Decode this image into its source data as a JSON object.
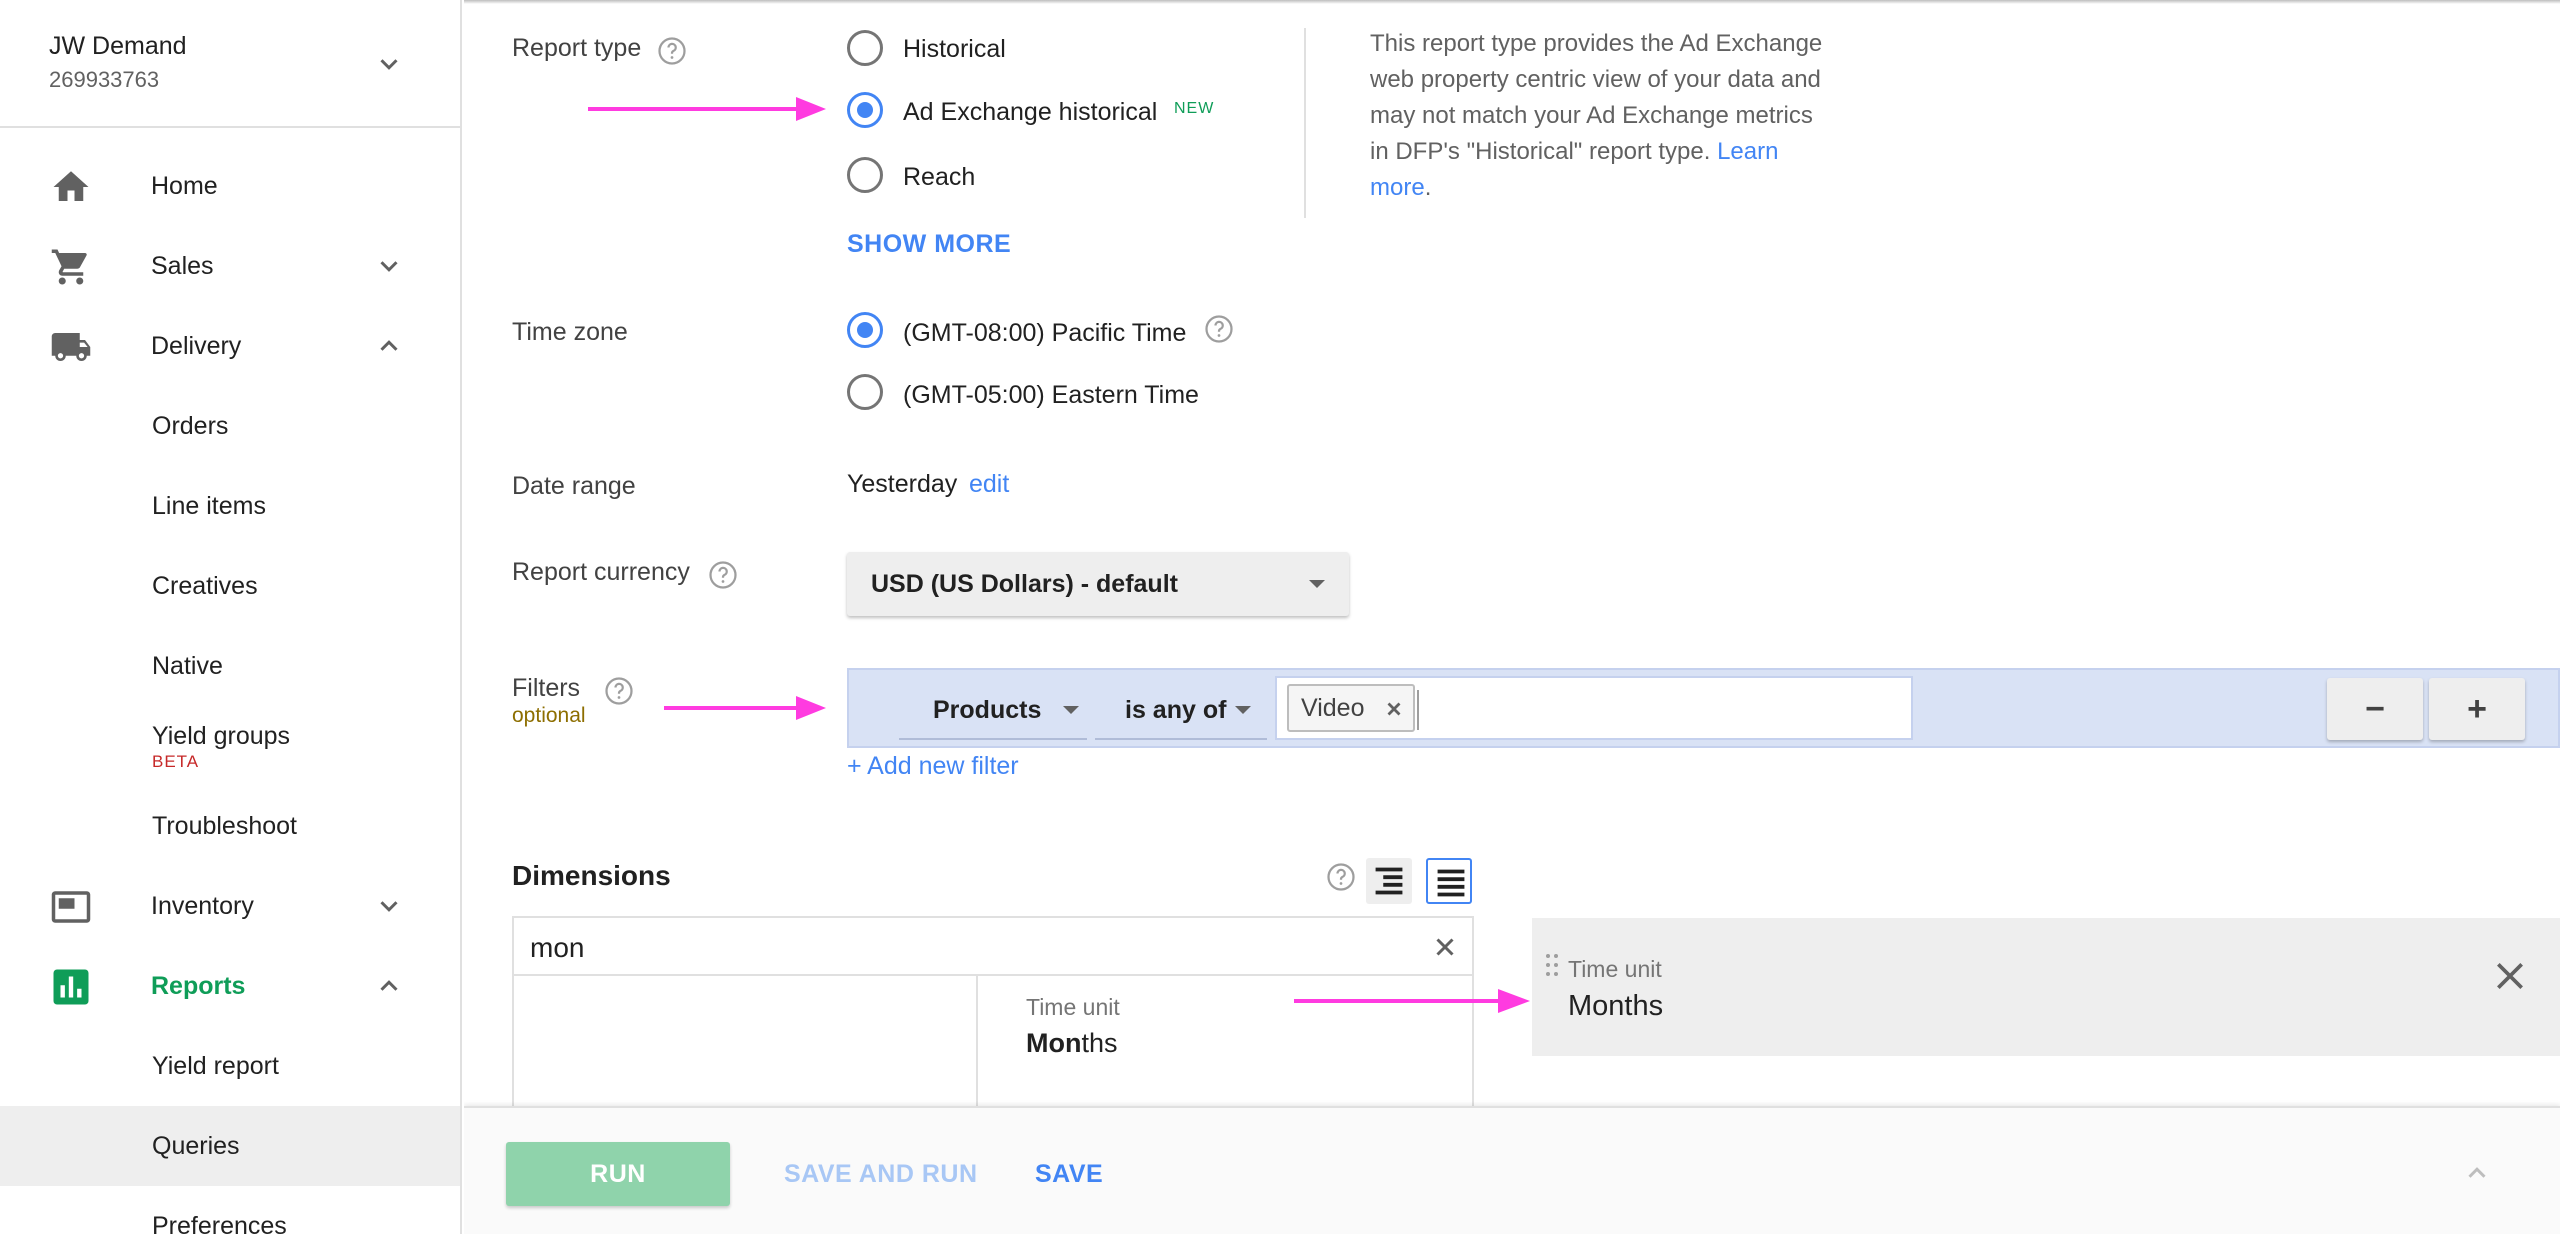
{
  "sidebar": {
    "account": {
      "name": "JW Demand",
      "id": "269933763",
      "chevron_icon": "chevron-down-icon"
    },
    "items": [
      {
        "label": "Home",
        "icon": "home-icon"
      },
      {
        "label": "Sales",
        "icon": "cart-icon",
        "chevron": "chevron-down-icon"
      },
      {
        "label": "Delivery",
        "icon": "truck-icon",
        "chevron": "chevron-up-icon"
      },
      {
        "label": "Orders"
      },
      {
        "label": "Line items"
      },
      {
        "label": "Creatives"
      },
      {
        "label": "Native"
      },
      {
        "label": "Yield groups",
        "badge": "BETA"
      },
      {
        "label": "Troubleshoot"
      },
      {
        "label": "Inventory",
        "icon": "inventory-icon",
        "chevron": "chevron-down-icon"
      },
      {
        "label": "Reports",
        "icon": "reports-icon",
        "chevron": "chevron-up-icon",
        "active": true
      },
      {
        "label": "Yield report"
      },
      {
        "label": "Queries",
        "selected": true
      },
      {
        "label": "Preferences"
      }
    ]
  },
  "report_type": {
    "label": "Report type",
    "options": [
      {
        "label": "Historical",
        "checked": false
      },
      {
        "label": "Ad Exchange historical",
        "checked": true,
        "tag": "NEW"
      },
      {
        "label": "Reach",
        "checked": false
      }
    ],
    "show_more": "SHOW MORE",
    "description_text": "This report type provides the Ad Exchange web property centric view of your data and may not match your Ad Exchange metrics in DFP's \"Historical\" report type.",
    "description_link": "Learn more",
    "description_end": "."
  },
  "time_zone": {
    "label": "Time zone",
    "options": [
      {
        "label": "(GMT-08:00) Pacific Time",
        "checked": true
      },
      {
        "label": "(GMT-05:00) Eastern Time",
        "checked": false
      }
    ]
  },
  "date_range": {
    "label": "Date range",
    "value": "Yesterday",
    "edit": "edit"
  },
  "currency": {
    "label": "Report currency",
    "value": "USD (US Dollars) - default"
  },
  "filters": {
    "label": "Filters",
    "optional": "optional",
    "dimension": "Products",
    "operator": "is any of",
    "chips": [
      "Video"
    ],
    "minus": "−",
    "plus": "+",
    "add": "+ Add new filter"
  },
  "dimensions": {
    "title": "Dimensions",
    "search_value": "mon",
    "result": {
      "category": "Time unit",
      "match": "Mon",
      "rest": "ths"
    },
    "selected": {
      "category": "Time unit",
      "name": "Months"
    }
  },
  "actions": {
    "run": "RUN",
    "save_and_run": "SAVE AND RUN",
    "save": "SAVE"
  },
  "colors": {
    "accent": "#4285f4",
    "reports_green": "#0f9d58",
    "annotation_arrow": "#ff3be0",
    "filter_bg": "#d9e2f5"
  }
}
